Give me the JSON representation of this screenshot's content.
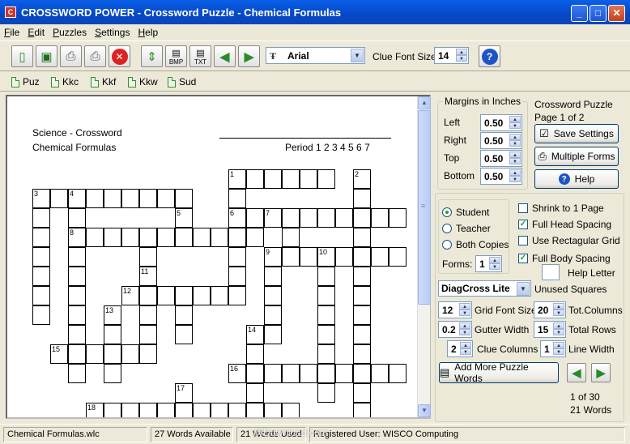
{
  "window": {
    "title": "CROSSWORD POWER - Crossword Puzzle - Chemical Formulas",
    "min": "_",
    "max": "□",
    "close": "✕"
  },
  "menu": [
    "File",
    "Edit",
    "Puzzles",
    "Settings",
    "Help"
  ],
  "toolbar": {
    "font_name": "Arial",
    "clue_font_size_label": "Clue Font Size:",
    "clue_font_size": "14",
    "bmp_label": "BMP",
    "txt_label": "TXT"
  },
  "links": [
    "Puz",
    "Kkc",
    "Kkf",
    "Kkw",
    "Sud"
  ],
  "document": {
    "header_left_1": "Science - Crossword",
    "header_left_2": "Chemical Formulas",
    "period": "Period  1 2 3 4 5 6 7"
  },
  "grid_numbers": [
    "1",
    "2",
    "3",
    "4",
    "5",
    "6",
    "7",
    "8",
    "9",
    "10",
    "11",
    "12",
    "13",
    "14",
    "15",
    "16",
    "17",
    "18"
  ],
  "margins": {
    "title": "Margins in Inches",
    "left_label": "Left",
    "left": "0.50",
    "right_label": "Right",
    "right": "0.50",
    "top_label": "Top",
    "top": "0.50",
    "bottom_label": "Bottom",
    "bottom": "0.50"
  },
  "info": {
    "line1": "Crossword Puzzle",
    "line2": "Page 1 of 2",
    "save_settings": "Save Settings",
    "multiple_forms": "Multiple Forms",
    "help": "Help"
  },
  "options": {
    "student": "Student",
    "teacher": "Teacher",
    "both_copies": "Both Copies",
    "selected": "Student",
    "forms_label": "Forms:",
    "forms": "1",
    "shrink": "Shrink to 1 Page",
    "shrink_checked": false,
    "full_head": "Full Head Spacing",
    "full_head_checked": true,
    "rect_grid": "Use Rectagular Grid",
    "rect_grid_checked": false,
    "full_body": "Full Body Spacing",
    "full_body_checked": true,
    "help_letter": "Help Letter",
    "unused_style": "DiagCross Lite",
    "unused_label": "Unused Squares",
    "grid_font_size": "12",
    "grid_font_size_label": "Grid Font Size",
    "tot_columns": "20",
    "tot_columns_label": "Tot.Columns",
    "gutter_width": "0.2",
    "gutter_width_label": "Gutter Width",
    "total_rows": "15",
    "total_rows_label": "Total Rows",
    "clue_columns": "2",
    "clue_columns_label": "Clue Columns",
    "line_width": "1",
    "line_width_label": "Line Width",
    "add_more": "Add More Puzzle Words",
    "counter": "1 of 30",
    "words_count": "21 Words"
  },
  "status": {
    "file": "Chemical Formulas.wlc",
    "available": "27 Words Available",
    "used": "21 Words Used",
    "user": "Registered User:  WISCO Computing"
  },
  "watermark": "@Download.com"
}
